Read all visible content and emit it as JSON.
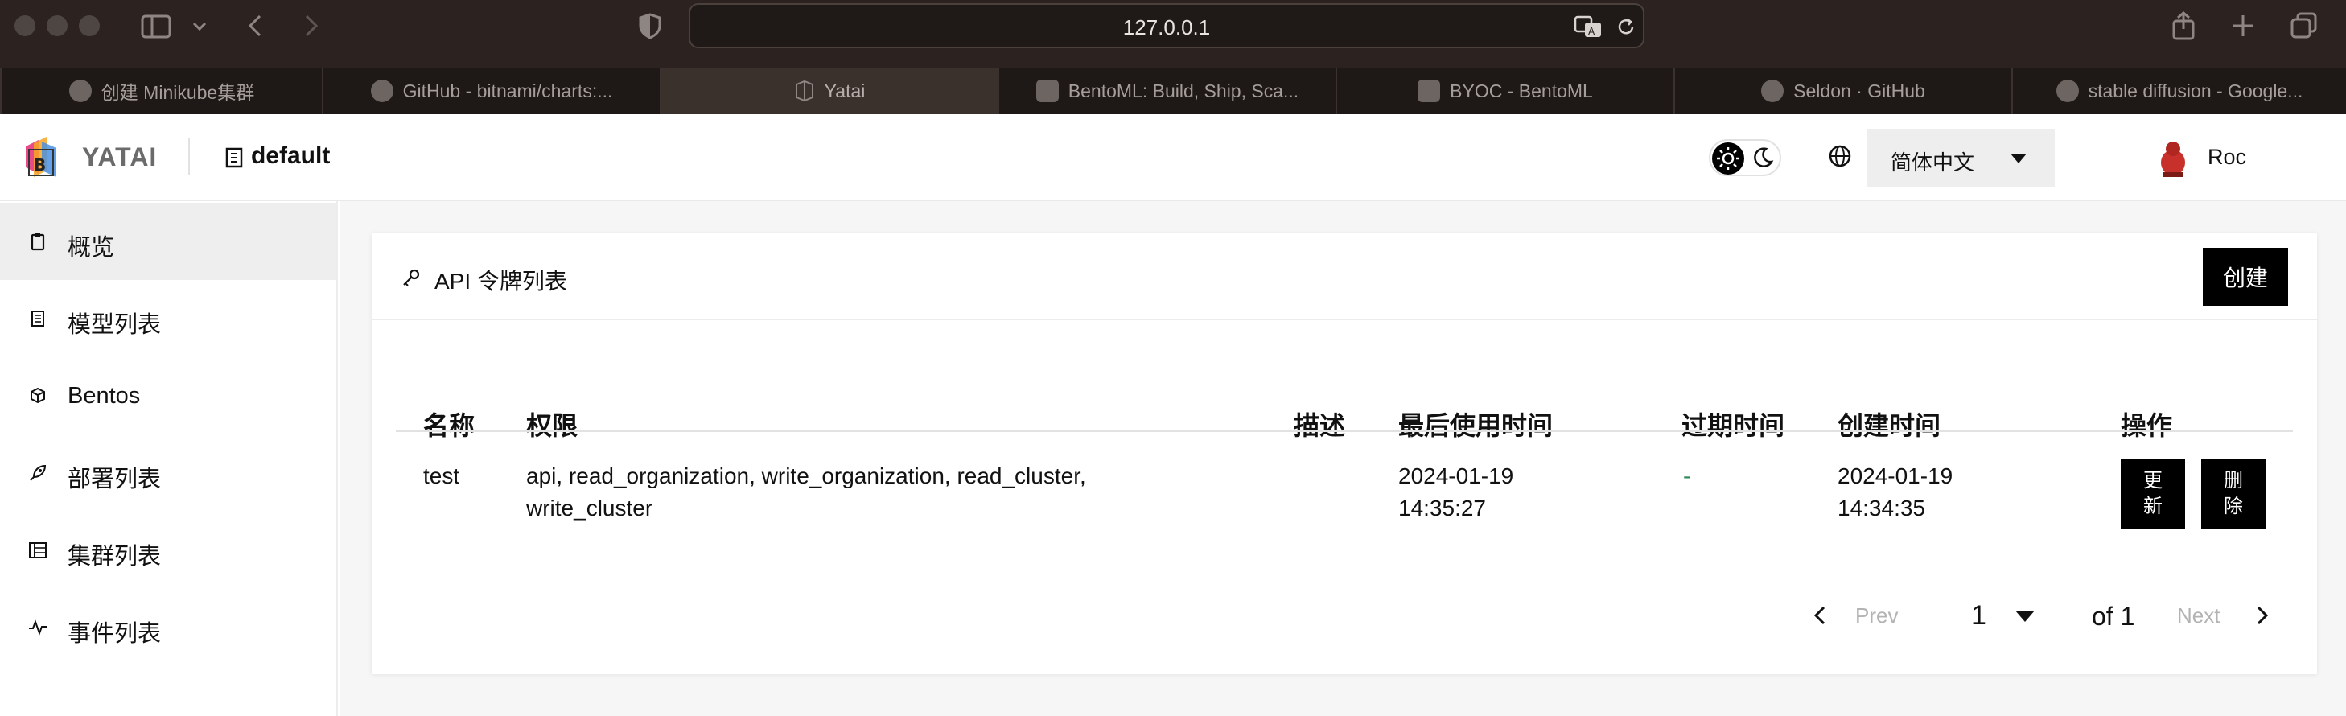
{
  "browser": {
    "url": "127.0.0.1",
    "tabs": [
      {
        "label": "创建 Minikube集群",
        "active": false
      },
      {
        "label": "GitHub - bitnami/charts:...",
        "active": false
      },
      {
        "label": "Yatai",
        "active": true
      },
      {
        "label": "BentoML: Build, Ship, Sca...",
        "active": false
      },
      {
        "label": "BYOC - BentoML",
        "active": false
      },
      {
        "label": "Seldon · GitHub",
        "active": false
      },
      {
        "label": "stable diffusion - Google...",
        "active": false
      }
    ],
    "icons": [
      "sidebar-icon",
      "chevron-down-icon",
      "back-icon",
      "forward-icon",
      "shield-icon",
      "translate-icon",
      "reload-icon",
      "share-icon",
      "new-tab-icon",
      "tabs-overview-icon"
    ]
  },
  "header": {
    "brand": "YATAI",
    "organization": "default",
    "language": "简体中文",
    "user": "Roc"
  },
  "sidebar": {
    "items": [
      {
        "label": "概览",
        "icon": "clipboard-icon",
        "active": true
      },
      {
        "label": "模型列表",
        "icon": "document-icon",
        "active": false
      },
      {
        "label": "Bentos",
        "icon": "cube-icon",
        "active": false
      },
      {
        "label": "部署列表",
        "icon": "rocket-icon",
        "active": false
      },
      {
        "label": "集群列表",
        "icon": "server-icon",
        "active": false
      },
      {
        "label": "事件列表",
        "icon": "activity-icon",
        "active": false
      }
    ]
  },
  "main": {
    "title": "API 令牌列表",
    "create_label": "创建",
    "columns": [
      "名称",
      "权限",
      "描述",
      "最后使用时间",
      "过期时间",
      "创建时间",
      "操作"
    ],
    "rows": [
      {
        "name": "test",
        "permissions_line1": "api, read_organization, write_organization, read_cluster,",
        "permissions_line2": "write_cluster",
        "description": "",
        "last_used_date": "2024-01-19",
        "last_used_time": "14:35:27",
        "expires": "-",
        "created_date": "2024-01-19",
        "created_time": "14:34:35",
        "update_line1": "更",
        "update_line2": "新",
        "delete_line1": "删",
        "delete_line2": "除"
      }
    ],
    "pagination": {
      "prev": "Prev",
      "page": "1",
      "of_total": "of 1",
      "next": "Next"
    }
  },
  "colors": {
    "chrome_bg": "#2c2320",
    "accent": "#000000",
    "expires_dash": "#2e8b57",
    "disabled_text": "#b3b3b3"
  }
}
